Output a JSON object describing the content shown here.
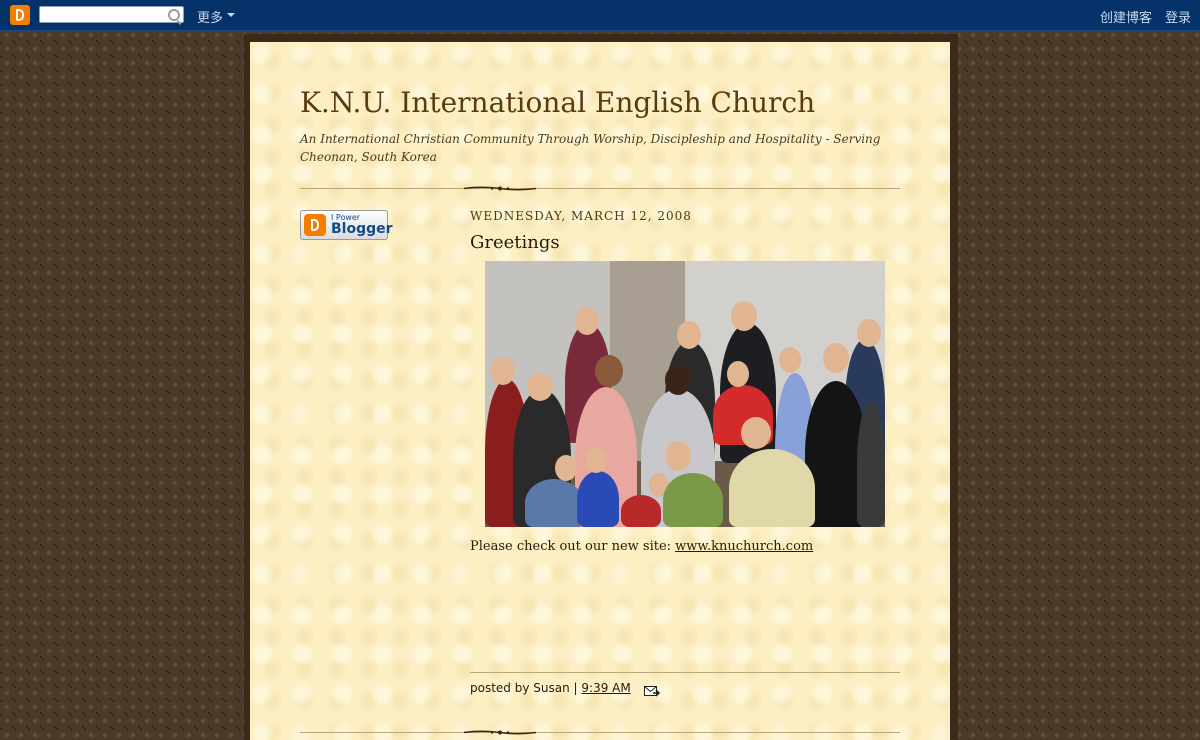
{
  "navbar": {
    "search_placeholder": "",
    "more_label": "更多",
    "create_blog_label": "创建博客",
    "login_label": "登录"
  },
  "blog": {
    "title": "K.N.U. International English Church",
    "description": "An International Christian Community Through Worship, Discipleship and Hospitality - Serving Cheonan, South Korea"
  },
  "sidebar": {
    "badge_small": "I Power",
    "badge_big": "Blogger"
  },
  "post": {
    "date": "WEDNESDAY, MARCH 12, 2008",
    "title": "Greetings",
    "body_text": "Please check out our new site: ",
    "link_text": "www.knuchurch.com",
    "footer_posted_by": "posted by Susan",
    "footer_sep": "|",
    "footer_time": "9:39 AM"
  },
  "colors": {
    "navbar_bg": "#06326a",
    "page_bg": "#4a3a28",
    "content_bg": "#fcefc4",
    "title_color": "#5a3a0f"
  }
}
